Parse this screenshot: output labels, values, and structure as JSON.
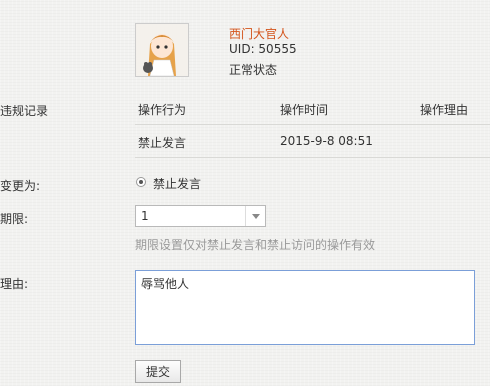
{
  "user": {
    "name": "西门大官人",
    "uid": "UID: 50555",
    "status": "正常状态"
  },
  "violations": {
    "label": "违规记录",
    "headers": [
      "操作行为",
      "操作时间",
      "操作理由"
    ],
    "rows": [
      {
        "action": "禁止发言",
        "time": "2015-9-8 08:51",
        "reason": ""
      }
    ]
  },
  "change": {
    "label": "变更为:",
    "option": "禁止发言"
  },
  "period": {
    "label": "期限:",
    "value": "1",
    "hint": "期限设置仅对禁止发言和禁止访问的操作有效"
  },
  "reason": {
    "label": "理由:",
    "value": "辱骂他人"
  },
  "submit_label": "提交",
  "colors": {
    "username": "#d4541b",
    "textarea_border": "#7b9fd8",
    "hint": "#999999"
  }
}
